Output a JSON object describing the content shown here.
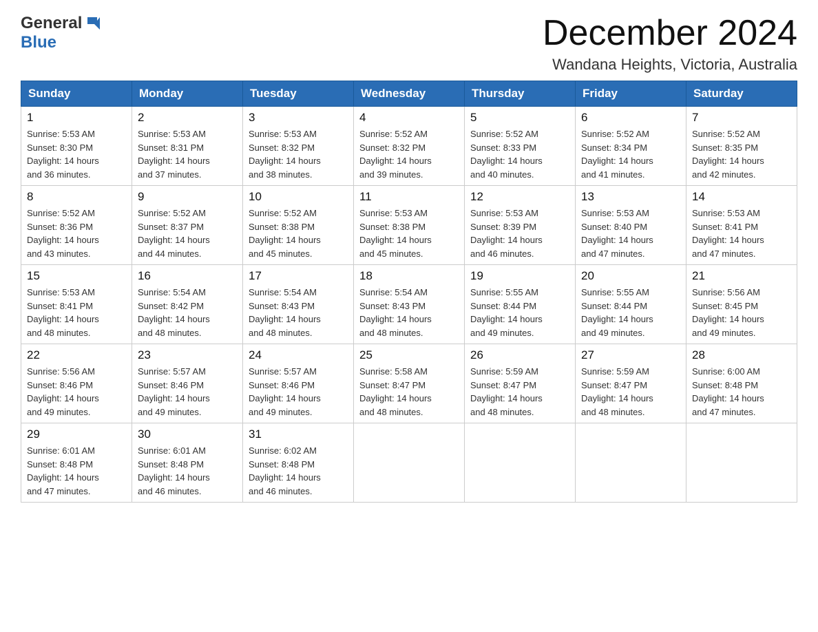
{
  "header": {
    "logo": {
      "general": "General",
      "blue": "Blue"
    },
    "title": "December 2024",
    "subtitle": "Wandana Heights, Victoria, Australia"
  },
  "days_of_week": [
    "Sunday",
    "Monday",
    "Tuesday",
    "Wednesday",
    "Thursday",
    "Friday",
    "Saturday"
  ],
  "weeks": [
    [
      {
        "day": "1",
        "sunrise": "5:53 AM",
        "sunset": "8:30 PM",
        "daylight": "14 hours and 36 minutes."
      },
      {
        "day": "2",
        "sunrise": "5:53 AM",
        "sunset": "8:31 PM",
        "daylight": "14 hours and 37 minutes."
      },
      {
        "day": "3",
        "sunrise": "5:53 AM",
        "sunset": "8:32 PM",
        "daylight": "14 hours and 38 minutes."
      },
      {
        "day": "4",
        "sunrise": "5:52 AM",
        "sunset": "8:32 PM",
        "daylight": "14 hours and 39 minutes."
      },
      {
        "day": "5",
        "sunrise": "5:52 AM",
        "sunset": "8:33 PM",
        "daylight": "14 hours and 40 minutes."
      },
      {
        "day": "6",
        "sunrise": "5:52 AM",
        "sunset": "8:34 PM",
        "daylight": "14 hours and 41 minutes."
      },
      {
        "day": "7",
        "sunrise": "5:52 AM",
        "sunset": "8:35 PM",
        "daylight": "14 hours and 42 minutes."
      }
    ],
    [
      {
        "day": "8",
        "sunrise": "5:52 AM",
        "sunset": "8:36 PM",
        "daylight": "14 hours and 43 minutes."
      },
      {
        "day": "9",
        "sunrise": "5:52 AM",
        "sunset": "8:37 PM",
        "daylight": "14 hours and 44 minutes."
      },
      {
        "day": "10",
        "sunrise": "5:52 AM",
        "sunset": "8:38 PM",
        "daylight": "14 hours and 45 minutes."
      },
      {
        "day": "11",
        "sunrise": "5:53 AM",
        "sunset": "8:38 PM",
        "daylight": "14 hours and 45 minutes."
      },
      {
        "day": "12",
        "sunrise": "5:53 AM",
        "sunset": "8:39 PM",
        "daylight": "14 hours and 46 minutes."
      },
      {
        "day": "13",
        "sunrise": "5:53 AM",
        "sunset": "8:40 PM",
        "daylight": "14 hours and 47 minutes."
      },
      {
        "day": "14",
        "sunrise": "5:53 AM",
        "sunset": "8:41 PM",
        "daylight": "14 hours and 47 minutes."
      }
    ],
    [
      {
        "day": "15",
        "sunrise": "5:53 AM",
        "sunset": "8:41 PM",
        "daylight": "14 hours and 48 minutes."
      },
      {
        "day": "16",
        "sunrise": "5:54 AM",
        "sunset": "8:42 PM",
        "daylight": "14 hours and 48 minutes."
      },
      {
        "day": "17",
        "sunrise": "5:54 AM",
        "sunset": "8:43 PM",
        "daylight": "14 hours and 48 minutes."
      },
      {
        "day": "18",
        "sunrise": "5:54 AM",
        "sunset": "8:43 PM",
        "daylight": "14 hours and 48 minutes."
      },
      {
        "day": "19",
        "sunrise": "5:55 AM",
        "sunset": "8:44 PM",
        "daylight": "14 hours and 49 minutes."
      },
      {
        "day": "20",
        "sunrise": "5:55 AM",
        "sunset": "8:44 PM",
        "daylight": "14 hours and 49 minutes."
      },
      {
        "day": "21",
        "sunrise": "5:56 AM",
        "sunset": "8:45 PM",
        "daylight": "14 hours and 49 minutes."
      }
    ],
    [
      {
        "day": "22",
        "sunrise": "5:56 AM",
        "sunset": "8:46 PM",
        "daylight": "14 hours and 49 minutes."
      },
      {
        "day": "23",
        "sunrise": "5:57 AM",
        "sunset": "8:46 PM",
        "daylight": "14 hours and 49 minutes."
      },
      {
        "day": "24",
        "sunrise": "5:57 AM",
        "sunset": "8:46 PM",
        "daylight": "14 hours and 49 minutes."
      },
      {
        "day": "25",
        "sunrise": "5:58 AM",
        "sunset": "8:47 PM",
        "daylight": "14 hours and 48 minutes."
      },
      {
        "day": "26",
        "sunrise": "5:59 AM",
        "sunset": "8:47 PM",
        "daylight": "14 hours and 48 minutes."
      },
      {
        "day": "27",
        "sunrise": "5:59 AM",
        "sunset": "8:47 PM",
        "daylight": "14 hours and 48 minutes."
      },
      {
        "day": "28",
        "sunrise": "6:00 AM",
        "sunset": "8:48 PM",
        "daylight": "14 hours and 47 minutes."
      }
    ],
    [
      {
        "day": "29",
        "sunrise": "6:01 AM",
        "sunset": "8:48 PM",
        "daylight": "14 hours and 47 minutes."
      },
      {
        "day": "30",
        "sunrise": "6:01 AM",
        "sunset": "8:48 PM",
        "daylight": "14 hours and 46 minutes."
      },
      {
        "day": "31",
        "sunrise": "6:02 AM",
        "sunset": "8:48 PM",
        "daylight": "14 hours and 46 minutes."
      },
      null,
      null,
      null,
      null
    ]
  ],
  "labels": {
    "sunrise": "Sunrise:",
    "sunset": "Sunset:",
    "daylight": "Daylight:"
  }
}
